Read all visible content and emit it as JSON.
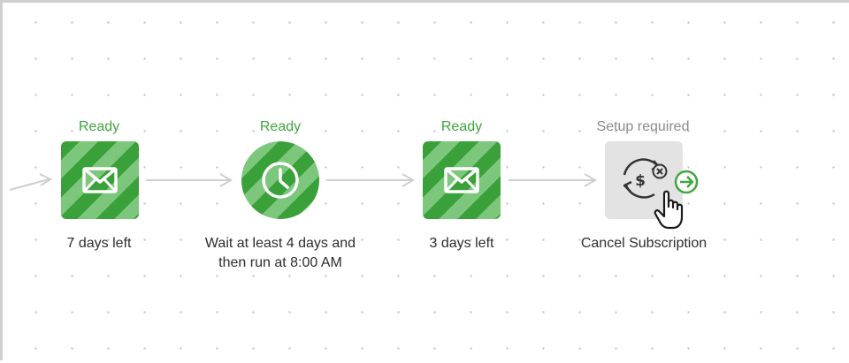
{
  "workflow": {
    "steps": [
      {
        "status": "Ready",
        "label": "7 days left",
        "icon": "mail-icon"
      },
      {
        "status": "Ready",
        "label": "Wait at least 4 days and",
        "label_line2": "then run at 8:00 AM",
        "icon": "clock-icon"
      },
      {
        "status": "Ready",
        "label": "3 days left",
        "icon": "mail-icon"
      },
      {
        "status": "Setup required",
        "label": "Cancel Subscription",
        "icon": "cancel-subscription-icon"
      }
    ]
  },
  "colors": {
    "ready": "#3ea63e",
    "setup": "#8a8a8a",
    "stripe_dark": "#3aa13a",
    "stripe_light": "#7cc77c",
    "connector": "#cfcfcf"
  }
}
